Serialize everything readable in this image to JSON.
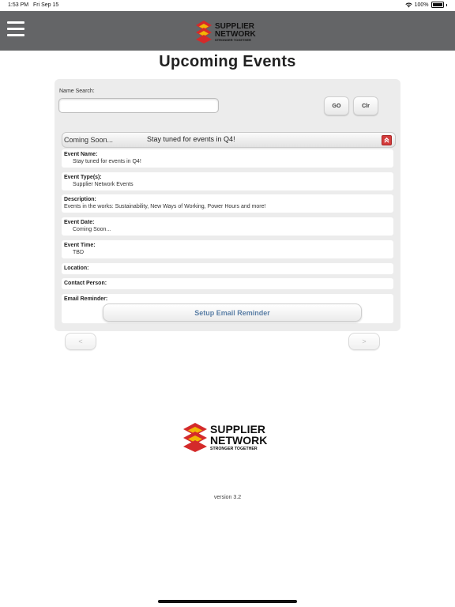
{
  "status_bar": {
    "time": "1:53 PM",
    "date": "Fri Sep 15",
    "battery": "100%"
  },
  "header": {
    "logo": {
      "line1": "SUPPLIER",
      "line2": "NETWORK",
      "tagline": "STRONGER TOGETHER"
    }
  },
  "page": {
    "title": "Upcoming Events"
  },
  "search": {
    "label": "Name Search:",
    "value": "",
    "placeholder": "",
    "go_label": "GO",
    "clear_label": "Clr"
  },
  "event": {
    "status": "Coming Soon...",
    "headline": "Stay tuned for events in Q4!",
    "fields": {
      "name": {
        "label": "Event Name:",
        "value": "Stay tuned for events in Q4!"
      },
      "types": {
        "label": "Event Type(s):",
        "value": "Supplier Network Events"
      },
      "description": {
        "label": "Description:",
        "value": "Events in the works: Sustainability, New Ways of Working, Power Hours and more!"
      },
      "date": {
        "label": "Event Date:",
        "value": "Coming Soon..."
      },
      "time": {
        "label": "Event Time:",
        "value": "TBD"
      },
      "location": {
        "label": "Location:"
      },
      "contact": {
        "label": "Contact Person:"
      },
      "reminder": {
        "label": "Email Reminder:",
        "button": "Setup Email Reminder"
      }
    }
  },
  "pager": {
    "prev": "<",
    "next": ">"
  },
  "footer": {
    "logo": {
      "line1": "SUPPLIER",
      "line2": "NETWORK",
      "tagline": "STRONGER TOGETHER"
    },
    "version": "version 3.2"
  },
  "colors": {
    "header_bg": "#646567",
    "logo_red": "#d42a2a",
    "logo_yellow": "#f2b705",
    "link_blue": "#5b7fa6",
    "panel_bg": "#ececec"
  },
  "icons": [
    "hamburger-icon",
    "wifi-icon",
    "battery-icon",
    "chevron-up-double-icon"
  ]
}
